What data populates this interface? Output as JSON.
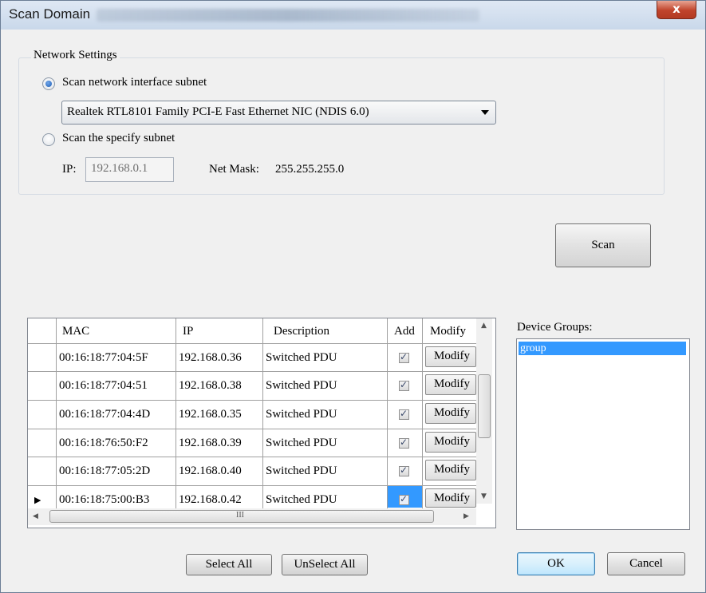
{
  "window": {
    "title": "Scan Domain",
    "close_glyph": "x"
  },
  "network_settings": {
    "legend": "Network Settings",
    "option_interface_label": "Scan network interface subnet",
    "option_interface_selected": true,
    "interface_select_value": "Realtek RTL8101 Family PCI-E Fast Ethernet NIC (NDIS 6.0)",
    "option_specify_label": "Scan the specify subnet",
    "option_specify_selected": false,
    "ip_label": "IP:",
    "ip_value": "192.168.0.1",
    "netmask_label": "Net Mask:",
    "netmask_value": "255.255.255.0"
  },
  "scan_button": "Scan",
  "device_table": {
    "columns": [
      "MAC",
      "IP",
      "Description",
      "Add",
      "Modify"
    ],
    "rows": [
      {
        "mac": "00:16:18:77:04:5F",
        "ip": "192.168.0.36",
        "description": "Switched PDU",
        "add": true,
        "modify": "Modify"
      },
      {
        "mac": "00:16:18:77:04:51",
        "ip": "192.168.0.38",
        "description": "Switched PDU",
        "add": true,
        "modify": "Modify"
      },
      {
        "mac": "00:16:18:77:04:4D",
        "ip": "192.168.0.35",
        "description": "Switched PDU",
        "add": true,
        "modify": "Modify"
      },
      {
        "mac": "00:16:18:76:50:F2",
        "ip": "192.168.0.39",
        "description": "Switched PDU",
        "add": true,
        "modify": "Modify"
      },
      {
        "mac": "00:16:18:77:05:2D",
        "ip": "192.168.0.40",
        "description": "Switched PDU",
        "add": true,
        "modify": "Modify"
      },
      {
        "mac": "00:16:18:75:00:B3",
        "ip": "192.168.0.42",
        "description": "Switched PDU",
        "add": true,
        "modify": "Modify"
      }
    ],
    "current_row_marker": "▶",
    "hscroll_grip": "III"
  },
  "device_groups": {
    "label": "Device Groups:",
    "items": [
      "group"
    ],
    "selected": "group"
  },
  "buttons": {
    "select_all": "Select All",
    "unselect_all": "UnSelect All",
    "ok": "OK",
    "cancel": "Cancel"
  }
}
